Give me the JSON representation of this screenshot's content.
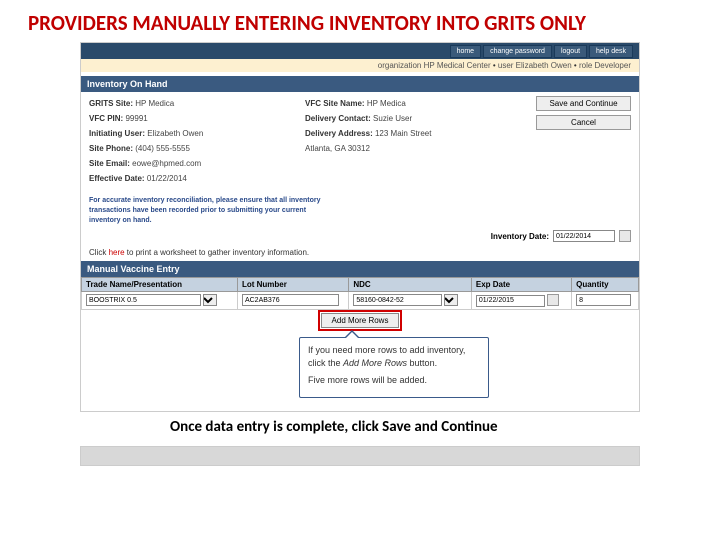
{
  "slide": {
    "title": "PROVIDERS MANUALLY ENTERING INVENTORY INTO GRITS ONLY",
    "instruction": "Once data entry is complete, click Save and Continue"
  },
  "topbar": {
    "home": "home",
    "change_pw": "change password",
    "logout": "logout",
    "help": "help desk"
  },
  "orgbar": {
    "org_lbl": "organization",
    "org_val": "HP Medical Center",
    "user_lbl": "user",
    "user_val": "Elizabeth Owen",
    "role_lbl": "role",
    "role_val": "Developer"
  },
  "section": {
    "inventory_onhand": "Inventory On Hand",
    "manual_entry": "Manual Vaccine Entry"
  },
  "site": {
    "grits_site_lbl": "GRITS Site:",
    "grits_site_val": "HP Medica",
    "vfc_pin_lbl": "VFC PIN:",
    "vfc_pin_val": "99991",
    "initiating_lbl": "Initiating User:",
    "initiating_val": "Elizabeth Owen",
    "phone_lbl": "Site Phone:",
    "phone_val": "(404) 555-5555",
    "email_lbl": "Site Email:",
    "email_val": "eowe@hpmed.com",
    "effective_lbl": "Effective Date:",
    "effective_val": "01/22/2014",
    "vfc_sitename_lbl": "VFC Site Name:",
    "vfc_sitename_val": "HP Medica",
    "deliv_contact_lbl": "Delivery Contact:",
    "deliv_contact_val": "Suzie User",
    "deliv_addr_lbl": "Delivery Address:",
    "deliv_addr_val1": "123 Main Street",
    "deliv_addr_val2": "Atlanta, GA 30312"
  },
  "actions": {
    "save_continue": "Save and Continue",
    "cancel": "Cancel",
    "add_rows": "Add More Rows"
  },
  "notes": {
    "accuracy1": "For accurate inventory reconciliation, please ensure that all inventory",
    "accuracy2": "transactions have been recorded prior to submitting your current",
    "accuracy3": "inventory on hand.",
    "inv_date_lbl": "Inventory Date:",
    "inv_date_val": "01/22/2014",
    "click_pre": "Click ",
    "click_link": "here",
    "click_post": " to print a worksheet to gather inventory information."
  },
  "table": {
    "th_trade": "Trade Name/Presentation",
    "th_lot": "Lot Number",
    "th_ndc": "NDC",
    "th_exp": "Exp Date",
    "th_qty": "Quantity",
    "row": {
      "trade": "BOOSTRIX 0.5",
      "lot": "AC2AB376",
      "ndc": "58160-0842-52",
      "exp": "01/22/2015",
      "qty": "8"
    }
  },
  "callout": {
    "line1a": "If you need more rows to add inventory, click the ",
    "line1b": "Add More Rows",
    "line1c": " button.",
    "line2": "Five more rows will be added."
  }
}
